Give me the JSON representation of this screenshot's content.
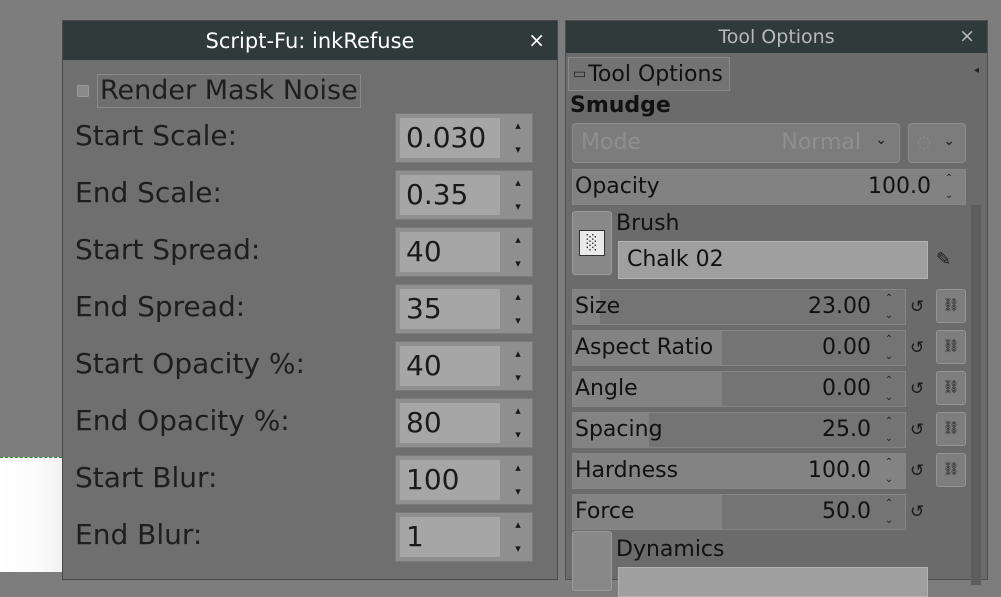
{
  "script_fu_dialog": {
    "title": "Script-Fu: inkRefuse",
    "close_glyph": "×",
    "checkbox_label": "Render Mask Noise",
    "params": [
      {
        "label": "Start Scale:",
        "value": "0.030"
      },
      {
        "label": "End Scale:",
        "value": "0.35"
      },
      {
        "label": "Start Spread:",
        "value": "40"
      },
      {
        "label": "End Spread:",
        "value": "35"
      },
      {
        "label": "Start Opacity %:",
        "value": "40"
      },
      {
        "label": "End Opacity %:",
        "value": "80"
      },
      {
        "label": "Start Blur:",
        "value": "100"
      },
      {
        "label": "End Blur:",
        "value": "1"
      }
    ]
  },
  "tool_options": {
    "window_title": "Tool Options",
    "close_glyph": "×",
    "tab_label": "Tool Options",
    "tool_name": "Smudge",
    "mode": {
      "label": "Mode",
      "value": "Normal"
    },
    "opacity": {
      "label": "Opacity",
      "value": "100.0",
      "fraction": 1.0
    },
    "brush": {
      "heading": "Brush",
      "name": "Chalk 02"
    },
    "sliders": [
      {
        "label": "Size",
        "value": "23.00",
        "fraction": 0.08
      },
      {
        "label": "Aspect Ratio",
        "value": "0.00",
        "fraction": 0.45
      },
      {
        "label": "Angle",
        "value": "0.00",
        "fraction": 0.45
      },
      {
        "label": "Spacing",
        "value": "25.0",
        "fraction": 0.23
      },
      {
        "label": "Hardness",
        "value": "100.0",
        "fraction": 1.0
      },
      {
        "label": "Force",
        "value": "50.0",
        "fraction": 0.45
      }
    ],
    "dynamics": {
      "heading": "Dynamics"
    }
  }
}
